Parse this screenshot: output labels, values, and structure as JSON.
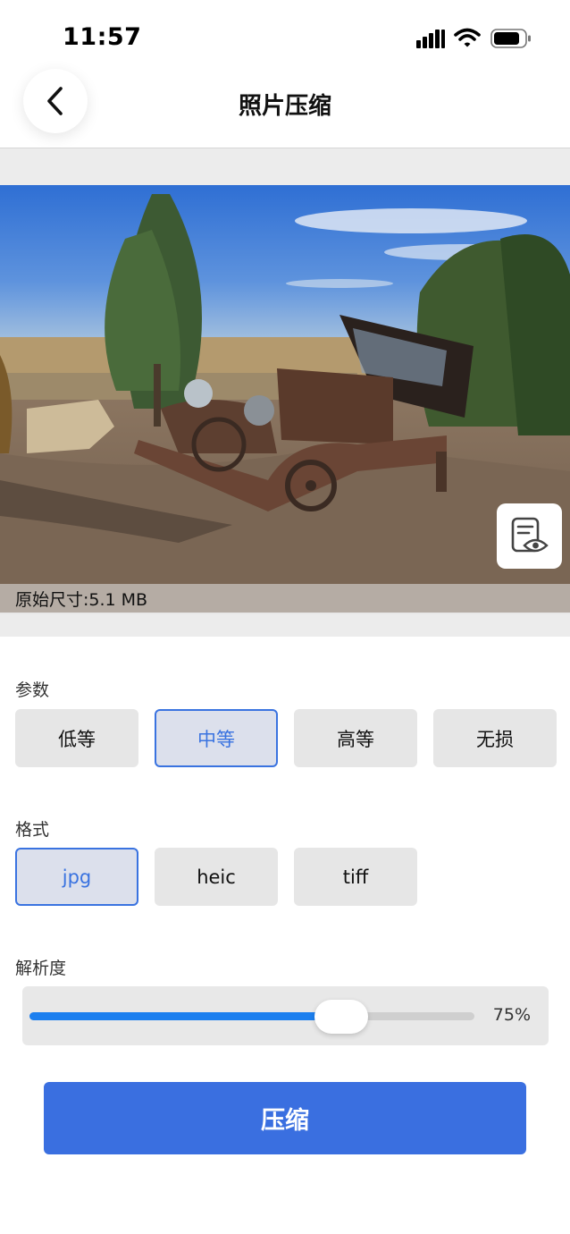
{
  "status_bar": {
    "time": "11:57"
  },
  "header": {
    "title": "照片压缩",
    "back_icon": "chevron-left-icon"
  },
  "preview": {
    "original_size": "原始尺寸:5.1 MB",
    "preview_icon": "document-eye-icon"
  },
  "params": {
    "label": "参数",
    "options": [
      "低等",
      "中等",
      "高等",
      "无损"
    ],
    "selected": "中等"
  },
  "format": {
    "label": "格式",
    "options": [
      "jpg",
      "heic",
      "tiff"
    ],
    "selected": "jpg"
  },
  "resolution": {
    "label": "解析度",
    "value_text": "75%",
    "fraction": 0.75
  },
  "compress_button": {
    "label": "压缩"
  },
  "colors": {
    "accent": "#3a6fe0",
    "slider": "#1c7fef",
    "selected_bg": "#dce0ec"
  }
}
